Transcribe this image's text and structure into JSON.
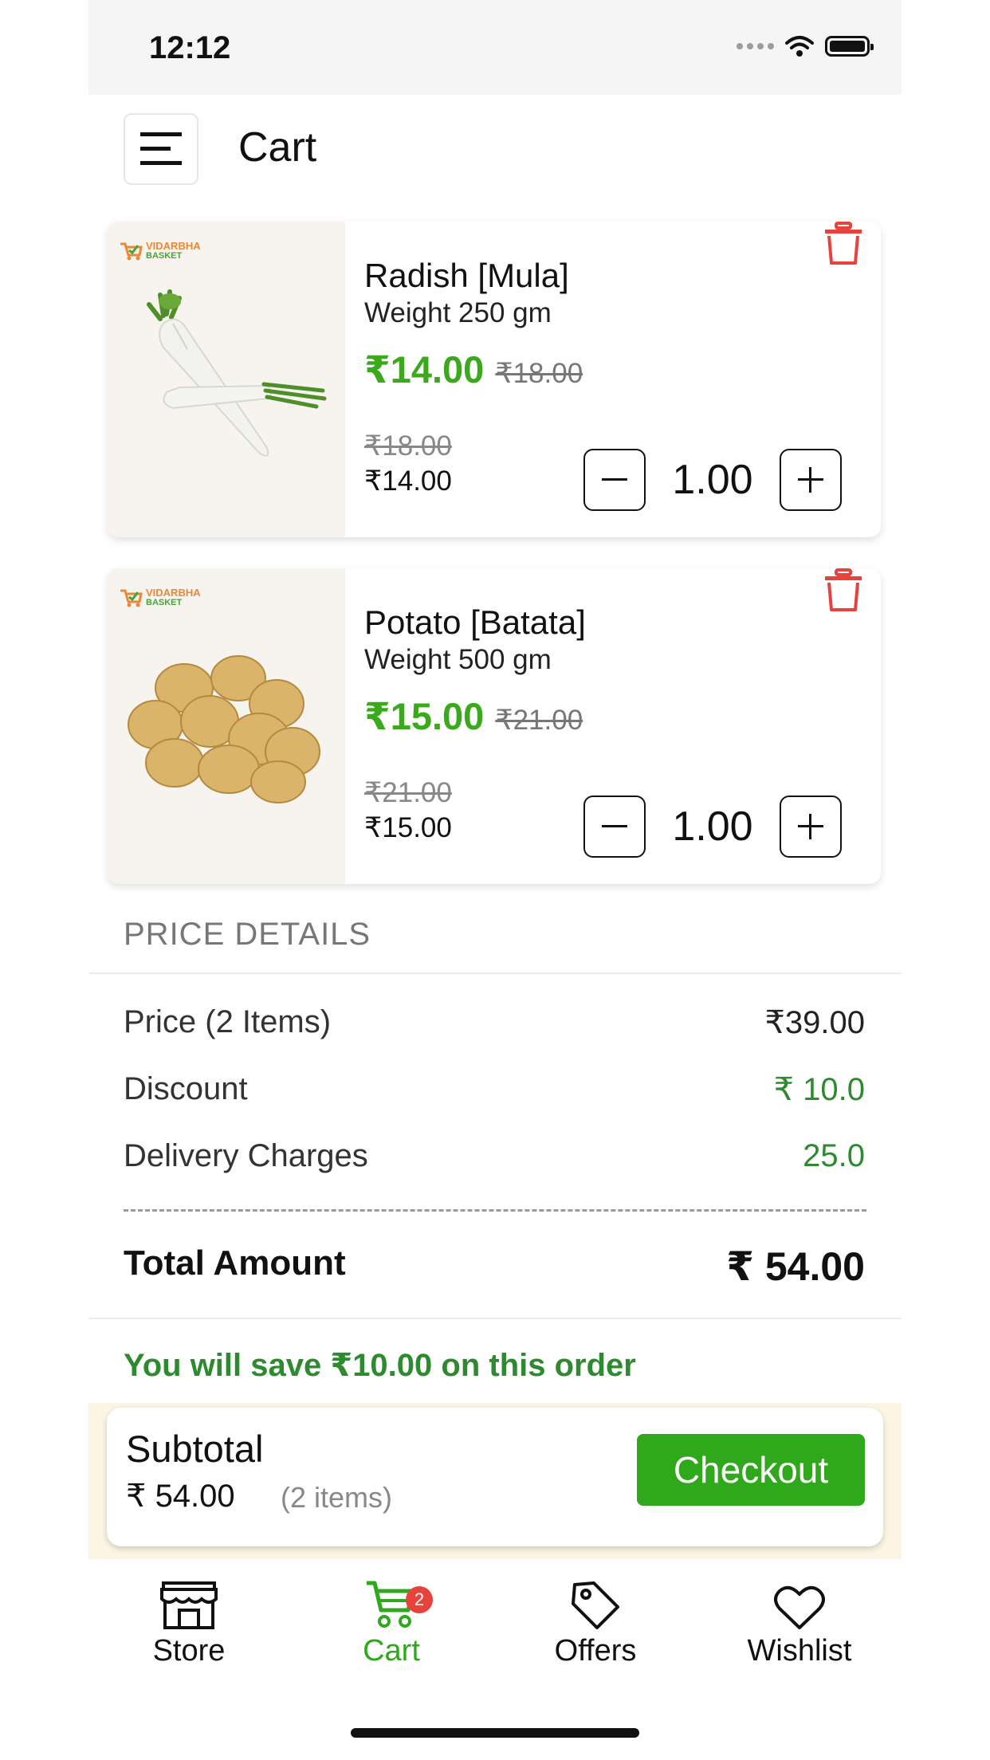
{
  "status_bar": {
    "time": "12:12"
  },
  "header": {
    "title": "Cart"
  },
  "cart_items": [
    {
      "name": "Radish [Mula]",
      "weight": "Weight 250 gm",
      "sale_price": "₹14.00",
      "mrp": "₹18.00",
      "mrp_small": "₹18.00",
      "final_small": "₹14.00",
      "quantity": "1.00",
      "image": "radish-image"
    },
    {
      "name": "Potato [Batata]",
      "weight": "Weight 500 gm",
      "sale_price": "₹15.00",
      "mrp": "₹21.00",
      "mrp_small": "₹21.00",
      "final_small": "₹15.00",
      "quantity": "1.00",
      "image": "potato-image"
    }
  ],
  "brand": {
    "line1": "VIDARBHA",
    "line2": "BASKET"
  },
  "price_details": {
    "header": "PRICE DETAILS",
    "rows": [
      {
        "label": "Price (2 Items)",
        "value": "₹39.00"
      },
      {
        "label": "Discount",
        "value": "₹ 10.0"
      },
      {
        "label": "Delivery Charges",
        "value": "25.0"
      }
    ],
    "total_label": "Total Amount",
    "total_value": "₹ 54.00",
    "savings_text": "You will save ₹10.00 on this order"
  },
  "subtotal": {
    "label": "Subtotal",
    "amount": "₹ 54.00",
    "items_count": "(2 items)",
    "checkout_label": "Checkout"
  },
  "bottom_nav": {
    "items": [
      {
        "label": "Store",
        "icon": "store-icon"
      },
      {
        "label": "Cart",
        "icon": "cart-icon",
        "badge": "2",
        "active": true
      },
      {
        "label": "Offers",
        "icon": "tag-icon"
      },
      {
        "label": "Wishlist",
        "icon": "heart-icon"
      }
    ]
  },
  "colors": {
    "accent_green": "#2fa81b",
    "price_green": "#3aaa1c",
    "delete_red": "#e8423c",
    "subtotal_strip": "#fdf5e4"
  }
}
